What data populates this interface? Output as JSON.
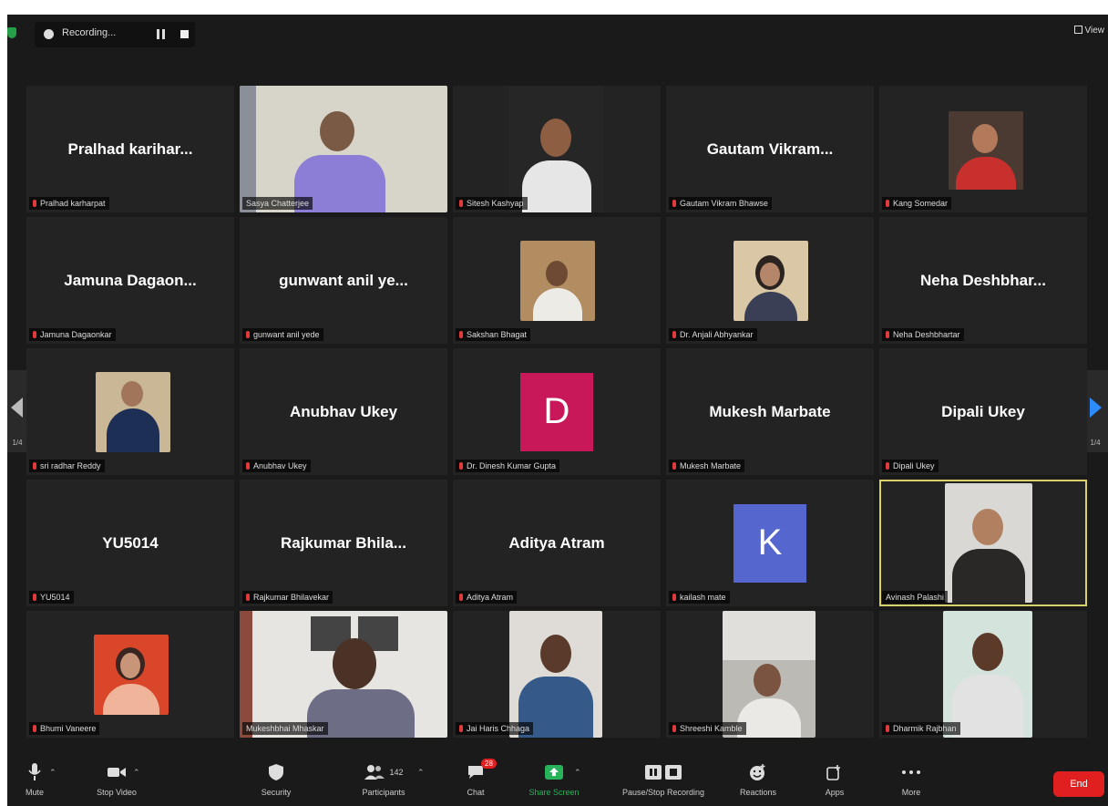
{
  "top_bar": {
    "recording_label": "Recording...",
    "view_label": "View"
  },
  "participants": [
    {
      "display_name": "Pralhad karihar...",
      "label": "Pralhad karharpat"
    },
    {
      "display_name": "",
      "label": "Sasya Chatterjee"
    },
    {
      "display_name": "",
      "label": "Sitesh Kashyap"
    },
    {
      "display_name": "Gautam Vikram...",
      "label": "Gautam Vikram Bhawse"
    },
    {
      "display_name": "",
      "label": "Kang Somedar"
    },
    {
      "display_name": "Jamuna Dagaon...",
      "label": "Jamuna Dagaonkar"
    },
    {
      "display_name": "gunwant anil ye...",
      "label": "gunwant anil yede"
    },
    {
      "display_name": "",
      "label": "Sakshan Bhagat"
    },
    {
      "display_name": "",
      "label": "Dr. Anjali Abhyankar"
    },
    {
      "display_name": "Neha Deshbhar...",
      "label": "Neha Deshbhartar"
    },
    {
      "display_name": "",
      "label": "sri radhar Reddy"
    },
    {
      "display_name": "Anubhav Ukey",
      "label": "Anubhav Ukey"
    },
    {
      "display_name": "",
      "avatar_letter": "D",
      "avatar_color": "#c8185a",
      "label": "Dr. Dinesh Kumar Gupta"
    },
    {
      "display_name": "Mukesh Marbate",
      "label": "Mukesh Marbate"
    },
    {
      "display_name": "Dipali Ukey",
      "label": "Dipali Ukey"
    },
    {
      "display_name": "YU5014",
      "label": "YU5014"
    },
    {
      "display_name": "Rajkumar Bhila...",
      "label": "Rajkumar Bhilavekar"
    },
    {
      "display_name": "Aditya Atram",
      "label": "Aditya Atram"
    },
    {
      "display_name": "",
      "avatar_letter": "K",
      "avatar_color": "#5567cf",
      "label": "kailash mate"
    },
    {
      "display_name": "",
      "label": "Avinash Palashi"
    },
    {
      "display_name": "",
      "label": "Bhumi Vaneere"
    },
    {
      "display_name": "",
      "label": "Mukeshbhai Mhaskar"
    },
    {
      "display_name": "",
      "label": "Jai Haris Chhaga"
    },
    {
      "display_name": "",
      "label": "Shreeshi Kamble"
    },
    {
      "display_name": "",
      "label": "Dharmik Rajbhan"
    }
  ],
  "nav": {
    "left_page": "1/4",
    "right_page": "1/4"
  },
  "toolbar": {
    "mute": "Mute",
    "stop_video": "Stop Video",
    "security": "Security",
    "participants": "Participants",
    "participants_count": "142",
    "chat": "Chat",
    "chat_badge": "28",
    "share_screen": "Share Screen",
    "pause_recording": "Pause/Stop Recording",
    "reactions": "Reactions",
    "apps": "Apps",
    "more": "More",
    "end": "End"
  }
}
